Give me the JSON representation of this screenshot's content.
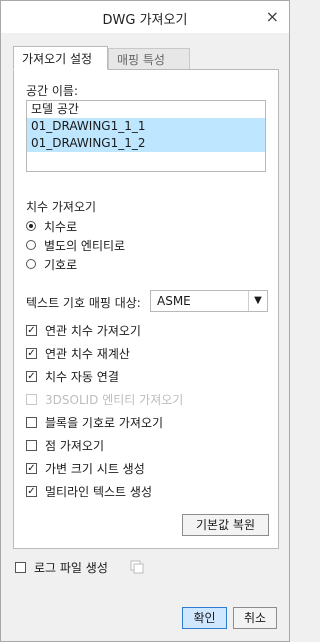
{
  "window": {
    "title": "DWG 가져오기",
    "close_glyph": "×"
  },
  "tabs": [
    {
      "label": "가져오기 설정",
      "active": true
    },
    {
      "label": "매핑 특성",
      "active": false
    }
  ],
  "space_name": {
    "label": "공간 이름:",
    "items": [
      "모델 공간",
      "01_DRAWING1_1_1",
      "01_DRAWING1_1_2"
    ],
    "selected": [
      1,
      2
    ]
  },
  "dimension_import": {
    "label": "치수 가져오기",
    "options": [
      "치수로",
      "별도의 엔티티로",
      "기호로"
    ],
    "selected_index": 0
  },
  "text_symbol_mapping": {
    "label": "텍스트 기호 매핑 대상:",
    "value": "ASME"
  },
  "options": [
    {
      "label": "연관 치수 가져오기",
      "checked": true,
      "enabled": true
    },
    {
      "label": "연관 치수 재계산",
      "checked": true,
      "enabled": true
    },
    {
      "label": "치수 자동 연결",
      "checked": true,
      "enabled": true
    },
    {
      "label": "3DSOLID 엔티티 가져오기",
      "checked": false,
      "enabled": false
    },
    {
      "label": "블록을 기호로 가져오기",
      "checked": false,
      "enabled": true
    },
    {
      "label": "점 가져오기",
      "checked": false,
      "enabled": true
    },
    {
      "label": "가변 크기 시트 생성",
      "checked": true,
      "enabled": true
    },
    {
      "label": "멀티라인 텍스트 생성",
      "checked": true,
      "enabled": true
    }
  ],
  "buttons": {
    "restore_defaults": "기본값 복원",
    "ok": "확인",
    "cancel": "취소"
  },
  "log": {
    "label": "로그 파일 생성",
    "checked": false,
    "icon": "copy-icon"
  },
  "colors": {
    "selection": "#bfe6ff",
    "primary_button": "#cfe7ff",
    "primary_border": "#2e7cd1"
  }
}
